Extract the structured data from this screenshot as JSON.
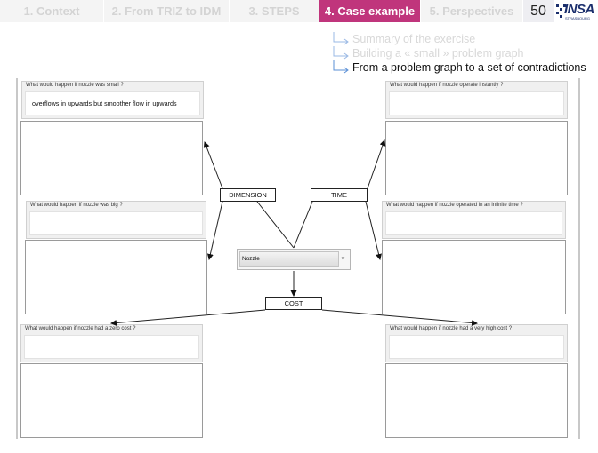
{
  "header": {
    "tabs": [
      {
        "label": "1. Context",
        "active": false
      },
      {
        "label": "2. From TRIZ to IDM",
        "active": false
      },
      {
        "label": "3. STEPS",
        "active": false
      },
      {
        "label": "4. Case example",
        "active": true
      },
      {
        "label": "5. Perspectives",
        "active": false
      }
    ],
    "slide_number": "50",
    "logo": {
      "text": "INSA",
      "tagline": "STRASBOURG"
    }
  },
  "breadcrumbs": [
    {
      "label": "Summary of the exercise",
      "current": false
    },
    {
      "label": "Building a « small » problem graph",
      "current": false
    },
    {
      "label": "From a problem graph to a set of contradictions",
      "current": true
    }
  ],
  "graph": {
    "questions": {
      "small": {
        "question": "What would happen if nozzle was small ?",
        "answer": "overflows in upwards but smoother flow in upwards"
      },
      "instant": {
        "question": "What would happen if nozzle operate instantly ?",
        "answer": ""
      },
      "big": {
        "question": "What would happen if nozzle was big ?",
        "answer": ""
      },
      "infinite": {
        "question": "What would happen if nozzle operated in an infinite time ?",
        "answer": ""
      },
      "zero_cost": {
        "question": "What would happen if nozzle had a zero cost ?",
        "answer": ""
      },
      "high_cost": {
        "question": "What would happen if nozzle had a very high cost ?",
        "answer": ""
      }
    },
    "parameters": {
      "dimension": "DIMENSION",
      "time": "TIME",
      "cost": "COST"
    },
    "element_select": {
      "value": "Nozzle"
    }
  },
  "colors": {
    "accent": "#c0357c",
    "inactive_tab": "#f4f4f4",
    "inactive_text": "#d4d4d4",
    "breadcrumb_arrow": "#5a8fd6"
  },
  "icons": {
    "breadcrumb": "arrow-right-icon",
    "dropdown": "chevron-down-icon"
  }
}
